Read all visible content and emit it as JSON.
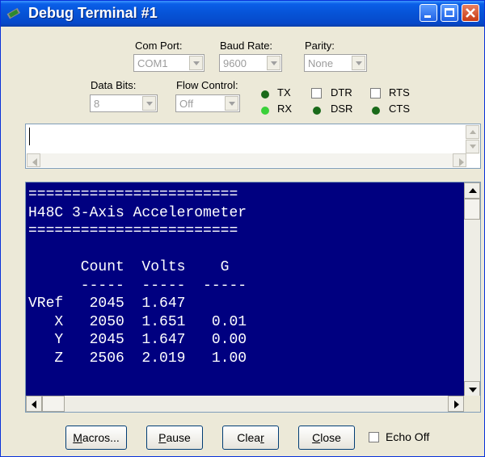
{
  "window": {
    "title": "Debug Terminal #1"
  },
  "settings": {
    "com_port": {
      "label": "Com Port:",
      "value": "COM1"
    },
    "baud_rate": {
      "label": "Baud Rate:",
      "value": "9600"
    },
    "parity": {
      "label": "Parity:",
      "value": "None"
    },
    "data_bits": {
      "label": "Data Bits:",
      "value": "8"
    },
    "flow_control": {
      "label": "Flow Control:",
      "value": "Off"
    }
  },
  "indicators": {
    "tx": "TX",
    "rx": "RX",
    "dtr": "DTR",
    "rts": "RTS",
    "dsr": "DSR",
    "cts": "CTS"
  },
  "terminal": {
    "lines": [
      "========================",
      "H48C 3-Axis Accelerometer",
      "========================",
      "",
      "      Count  Volts    G",
      "      -----  -----  -----",
      "VRef   2045  1.647",
      "   X   2050  1.651   0.01",
      "   Y   2045  1.647   0.00",
      "   Z   2506  2.019   1.00"
    ]
  },
  "buttons": {
    "macros": {
      "pre": "",
      "ul": "M",
      "post": "acros..."
    },
    "pause": {
      "pre": "",
      "ul": "P",
      "post": "ause"
    },
    "clear": {
      "pre": "Clea",
      "ul": "r",
      "post": ""
    },
    "close": {
      "pre": "",
      "ul": "C",
      "post": "lose"
    },
    "echo_off": "Echo Off"
  },
  "colors": {
    "terminal_bg": "#000080",
    "terminal_fg": "#ffffff",
    "title_bar": "#0653d6",
    "led_on": "#3ad13a",
    "led_off": "#1a6a1a"
  }
}
